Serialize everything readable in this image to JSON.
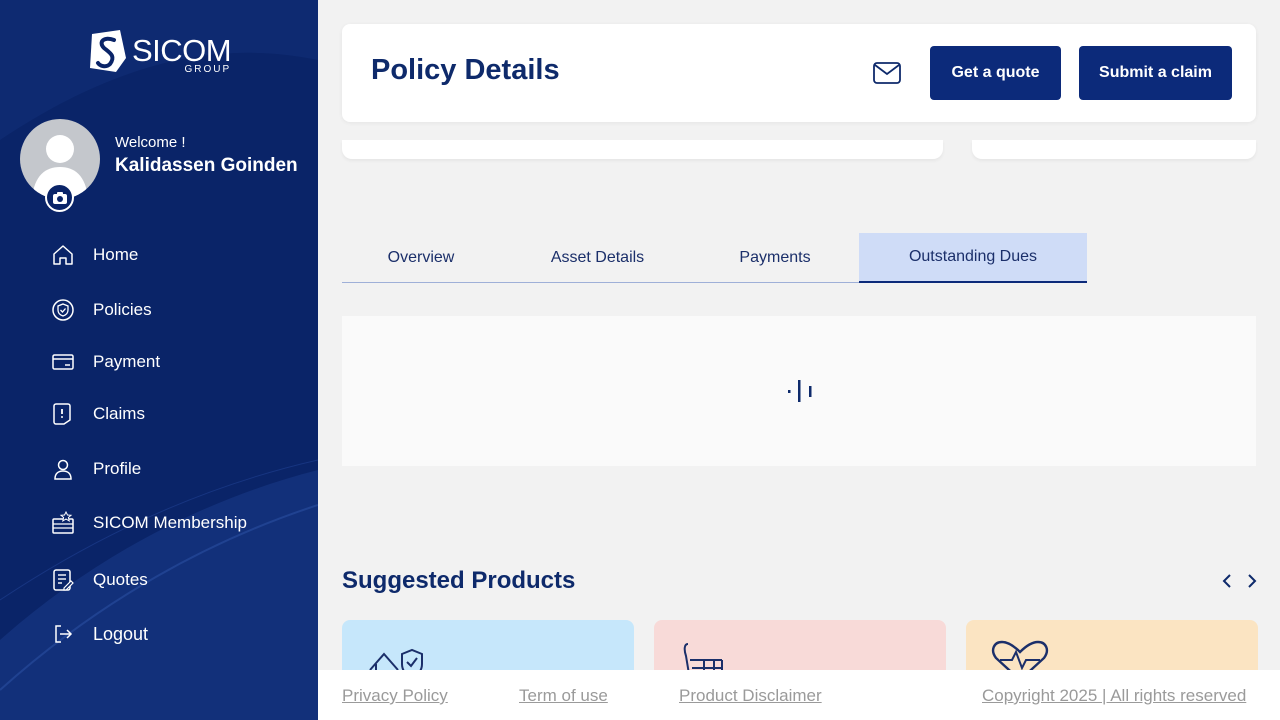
{
  "brand": {
    "name": "SICOM",
    "sub": "GROUP"
  },
  "user": {
    "welcome": "Welcome !",
    "name": "Kalidassen Goinden"
  },
  "sidebar": {
    "items": [
      {
        "label": "Home",
        "icon": "home-icon"
      },
      {
        "label": "Policies",
        "icon": "shield-check-icon"
      },
      {
        "label": "Payment",
        "icon": "card-icon"
      },
      {
        "label": "Claims",
        "icon": "claim-doc-icon"
      },
      {
        "label": "Profile",
        "icon": "user-icon"
      },
      {
        "label": "SICOM Membership",
        "icon": "membership-icon"
      },
      {
        "label": "Quotes",
        "icon": "quote-doc-icon"
      },
      {
        "label": "Logout",
        "icon": "logout-icon"
      }
    ]
  },
  "header": {
    "title": "Policy Details",
    "quote_label": "Get a quote",
    "claim_label": "Submit a claim"
  },
  "tabs": [
    {
      "label": "Overview",
      "active": false
    },
    {
      "label": "Asset Details",
      "active": false
    },
    {
      "label": "Payments",
      "active": false
    },
    {
      "label": "Outstanding Dues",
      "active": true
    }
  ],
  "suggested": {
    "title": "Suggested Products",
    "cards": [
      {
        "icon": "home-protection-icon",
        "color": "#c6e7fb"
      },
      {
        "icon": "chair-icon",
        "color": "#f8dad8"
      },
      {
        "icon": "heart-pulse-icon",
        "color": "#fbe4c2"
      }
    ]
  },
  "footer": {
    "privacy": "Privacy Policy",
    "terms": "Term of use",
    "disclaimer": "Product Disclaimer",
    "copyright": "Copyright 2025 | All rights reserved"
  },
  "colors": {
    "sidebar_bg": "#0a2468",
    "primary": "#0c2a7a",
    "active_tab": "#cfdcf7",
    "title": "#0e2a6b"
  }
}
